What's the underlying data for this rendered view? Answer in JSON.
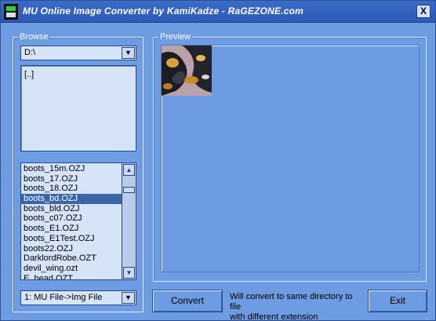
{
  "window": {
    "title": "MU Online Image Converter by KamiKadze - RaGEZONE.com",
    "close_label": "X"
  },
  "browse": {
    "legend": "Browse",
    "drive": "D:\\",
    "directories": [
      "[..]"
    ],
    "files": [
      "boots_15m.OZJ",
      "boots_17.OZJ",
      "boots_18.OZJ",
      "boots_bd.OZJ",
      "boots_bld.OZJ",
      "boots_c07.OZJ",
      "boots_E1.OZJ",
      "boots_E1Test.OZJ",
      "boots22.OZJ",
      "DarklordRobe.OZT",
      "devil_wing.ozt",
      "E_head.OZT"
    ],
    "selected_file": "boots_bd.OZJ",
    "mode": "1: MU File->Img File"
  },
  "preview": {
    "legend": "Preview"
  },
  "actions": {
    "convert_label": "Convert",
    "note_line1": "Will convert to same directory to file",
    "note_line2": "with different extension",
    "exit_label": "Exit"
  },
  "colors": {
    "background": "#6e9ce3",
    "titlebar": "#2c5ab4",
    "list_bg": "#d6e4f8",
    "selection": "#3a66a8"
  }
}
